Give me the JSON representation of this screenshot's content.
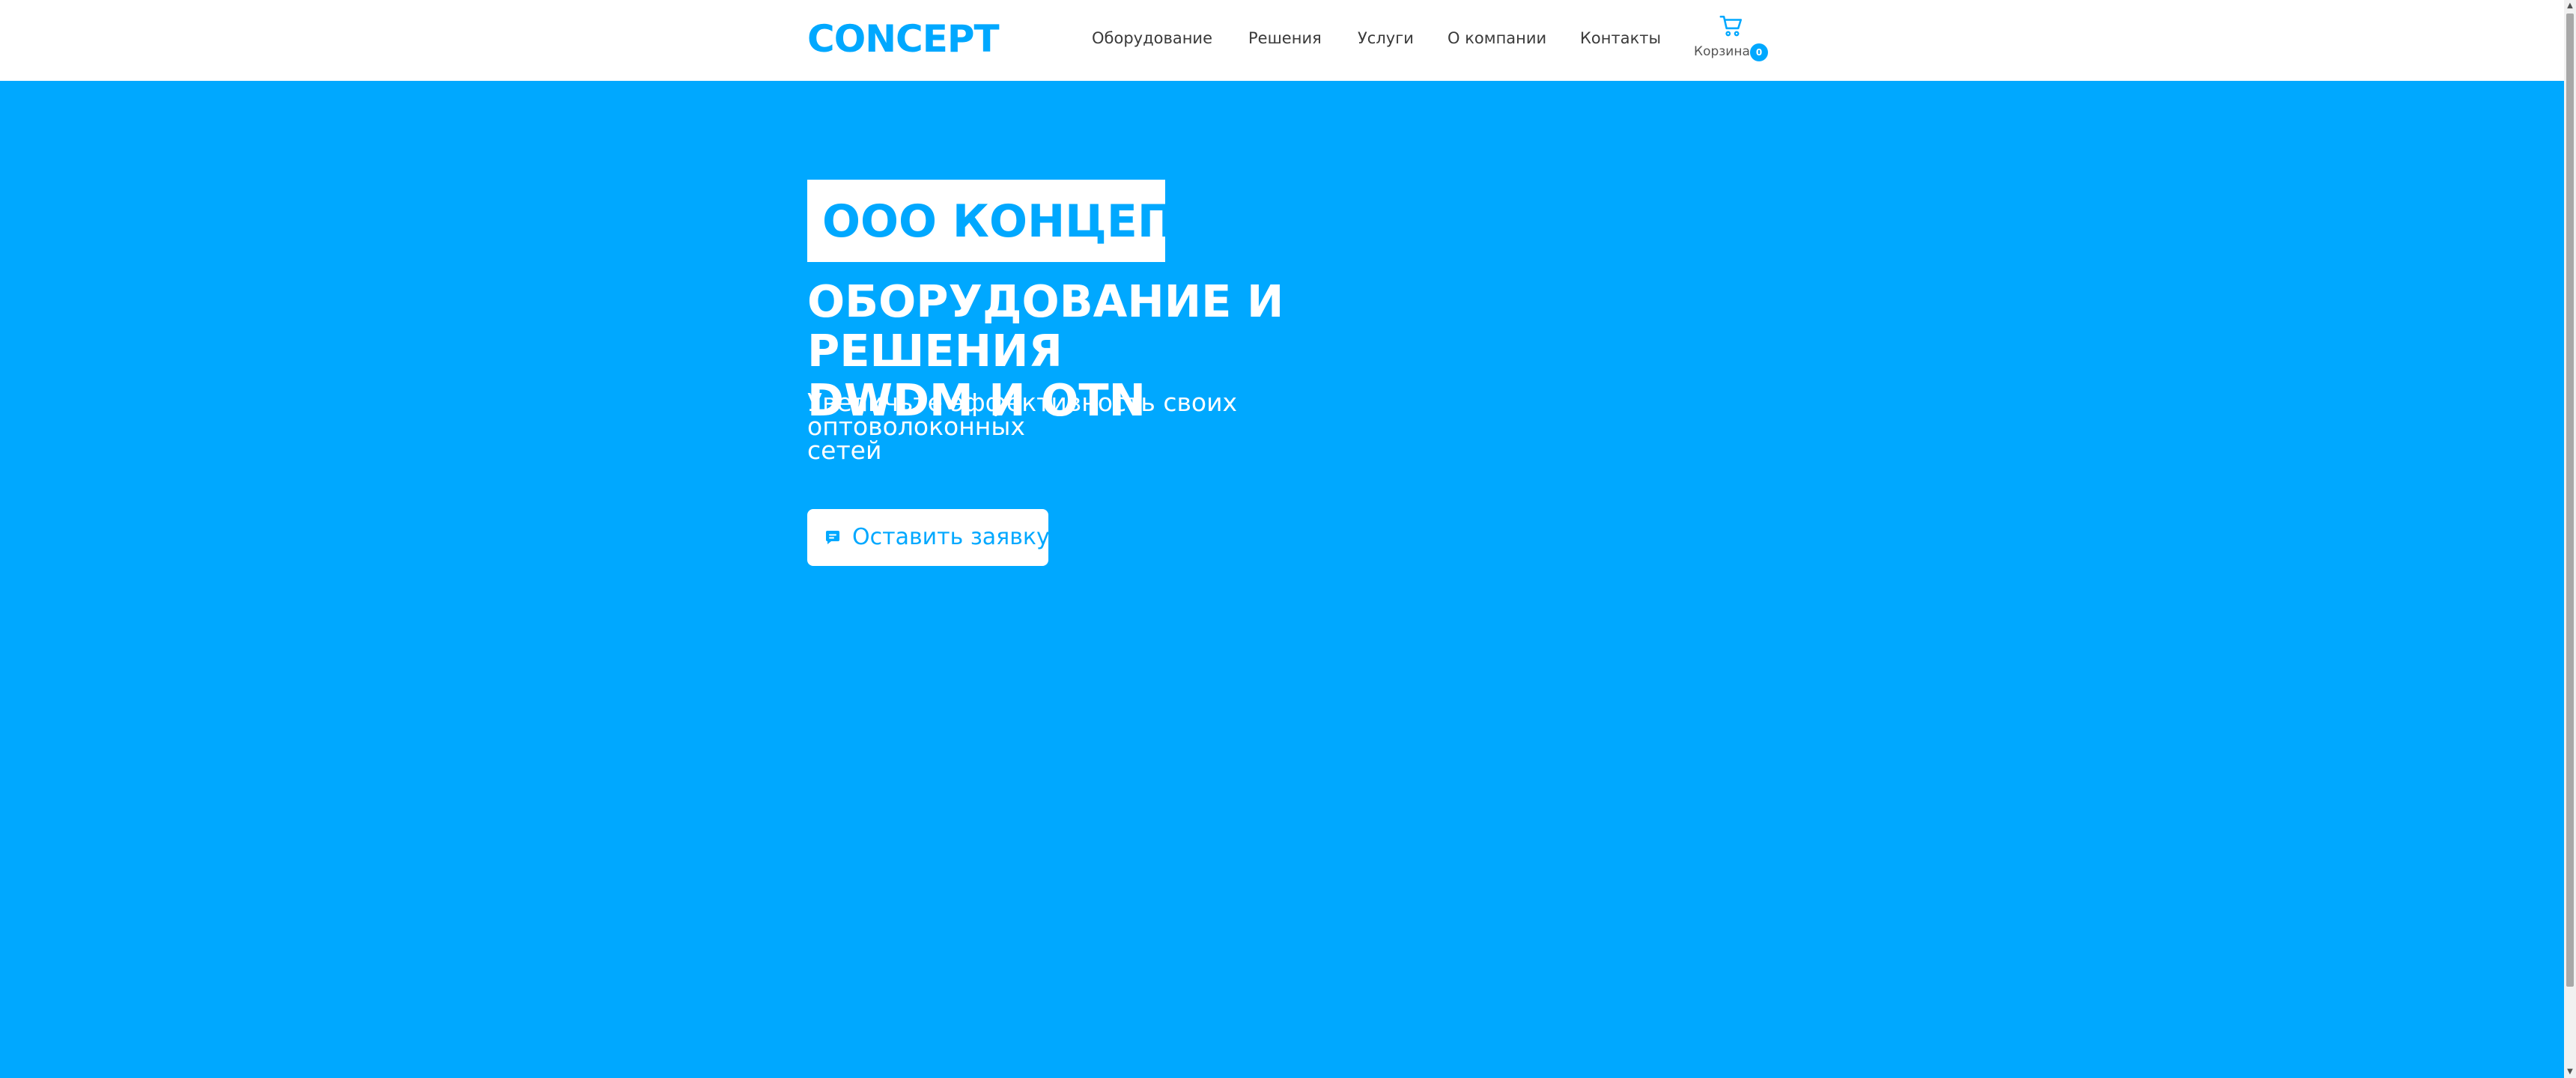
{
  "header": {
    "logo": "CONCEPT",
    "nav": [
      {
        "label": "Оборудование"
      },
      {
        "label": "Решения"
      },
      {
        "label": "Услуги"
      },
      {
        "label": "О компании"
      },
      {
        "label": "Контакты"
      }
    ],
    "cart": {
      "icon": "cart-icon",
      "label": "Корзина",
      "count": "0"
    }
  },
  "hero": {
    "company": "ООО КОНЦЕПТ",
    "title_line1": "ОБОРУДОВАНИЕ И РЕШЕНИЯ",
    "title_line2": "DWDM И OTN",
    "subtitle_line1": "Увеличьте эффективность своих оптоволоконных",
    "subtitle_line2": "сетей",
    "cta": {
      "icon": "message-icon",
      "label": "Оставить заявку"
    }
  },
  "colors": {
    "brand": "#00a8ff",
    "header_bg": "#ffffff",
    "text_dark": "#3a3a3a"
  }
}
